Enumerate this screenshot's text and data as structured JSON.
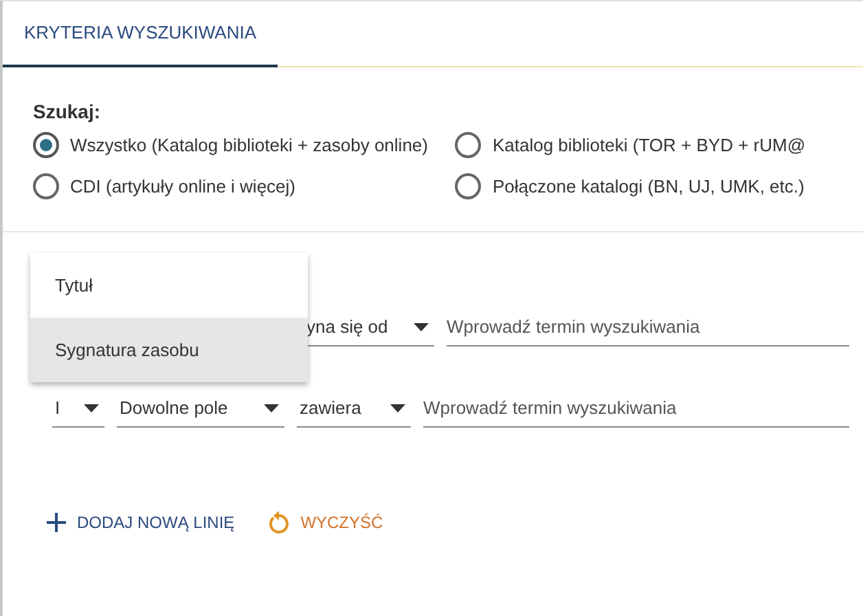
{
  "tabs": [
    {
      "label": "KRYTERIA WYSZUKIWANIA",
      "selected": true
    }
  ],
  "scope": {
    "label": "Szukaj:",
    "options": [
      {
        "label": "Wszystko (Katalog biblioteki + zasoby online)",
        "selected": true
      },
      {
        "label": "Katalog biblioteki (TOR + BYD + rUM@",
        "selected": false
      },
      {
        "label": "CDI (artykuły online i więcej)",
        "selected": false
      },
      {
        "label": "Połączone katalogi (BN, UJ, UMK, etc.)",
        "selected": false
      }
    ]
  },
  "menu": {
    "items": [
      {
        "label": "Tytuł",
        "selected": false
      },
      {
        "label": "Sygnatura zasobu",
        "selected": true
      }
    ]
  },
  "rows": [
    {
      "operator": "",
      "field": "",
      "match": "yna się od",
      "placeholder": "Wprowadź termin wyszukiwania"
    },
    {
      "operator": "I",
      "field": "Dowolne pole",
      "match": "zawiera",
      "placeholder": "Wprowadź termin wyszukiwania"
    }
  ],
  "actions": [
    {
      "kind": "add",
      "label": "DODAJ NOWĄ LINIĘ"
    },
    {
      "kind": "clear",
      "label": "WYCZYŚĆ"
    }
  ]
}
